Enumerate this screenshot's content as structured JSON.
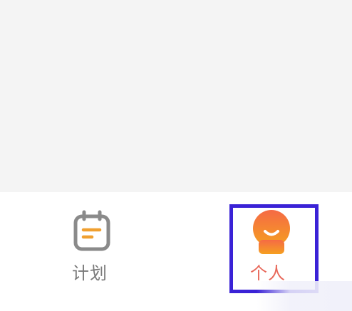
{
  "tab_bar": {
    "tabs": [
      {
        "label": "计划",
        "icon": "calendar-icon",
        "active": false
      },
      {
        "label": "个人",
        "icon": "smile-face-icon",
        "active": true
      }
    ]
  },
  "colors": {
    "content_background": "#f4f4f4",
    "tab_bar_background": "#ffffff",
    "inactive_label": "#7a7a7a",
    "active_label": "#e8685a",
    "accent_orange": "#f08a2a",
    "highlight_border": "#3a22d6"
  }
}
